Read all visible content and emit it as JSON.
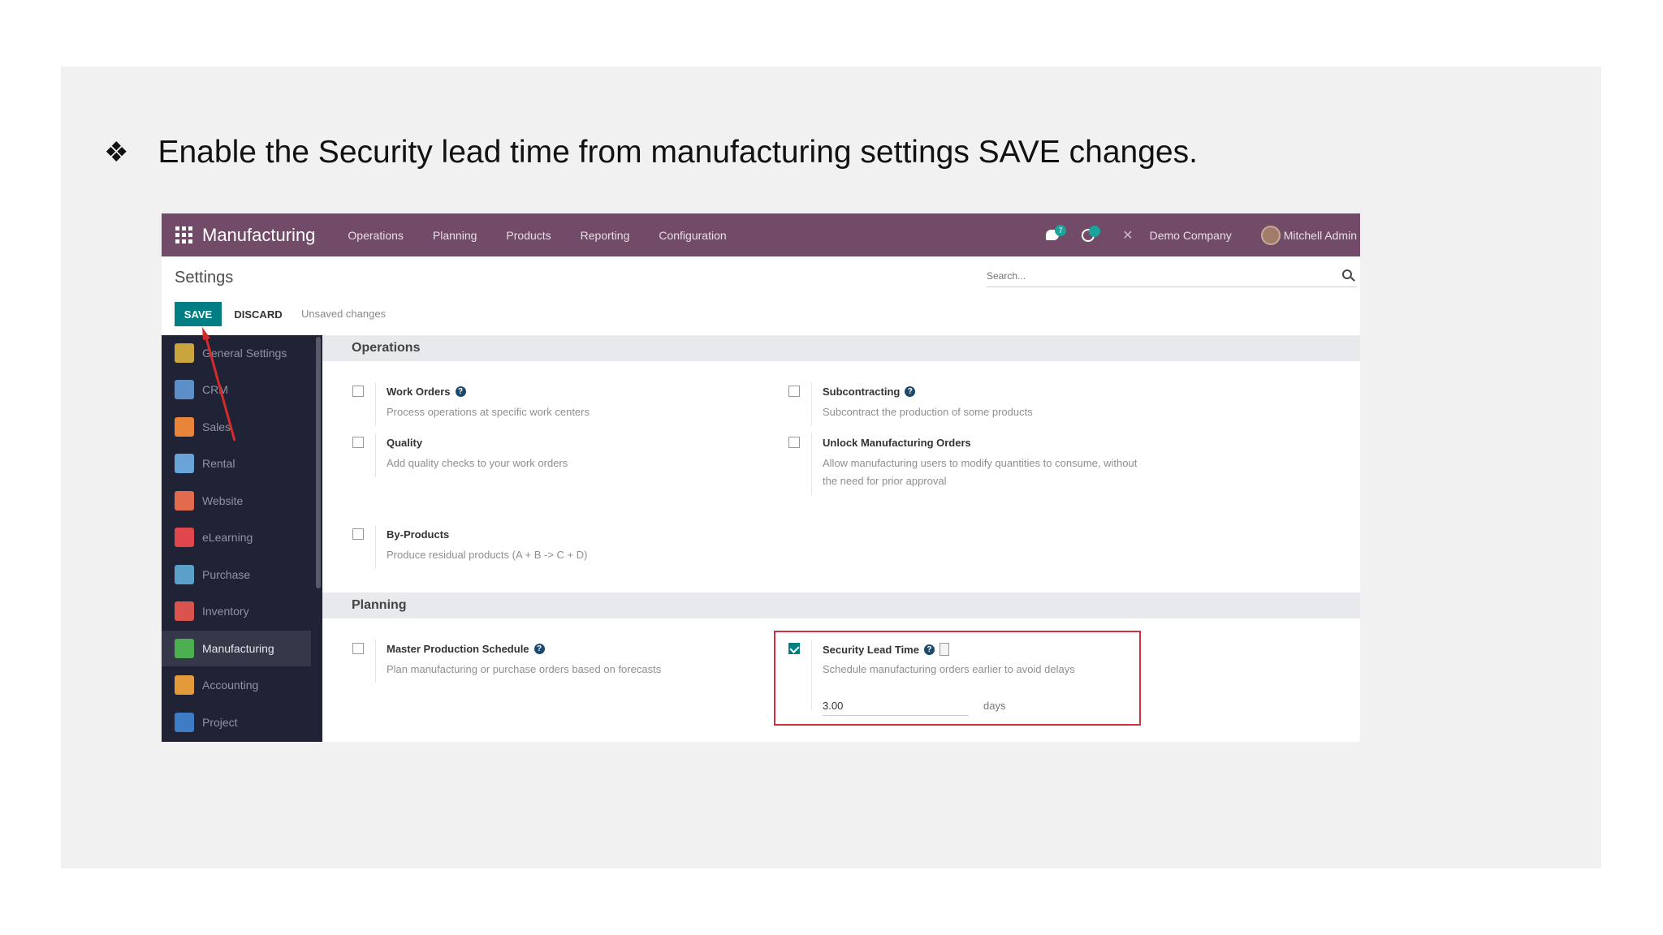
{
  "instruction": {
    "bullet": "❖",
    "text": "Enable the Security lead time from manufacturing settings SAVE changes."
  },
  "topbar": {
    "app_name": "Manufacturing",
    "menus": [
      "Operations",
      "Planning",
      "Products",
      "Reporting",
      "Configuration"
    ],
    "messages_badge": "7",
    "activities_badge": "",
    "company": "Demo Company",
    "user": "Mitchell Admin",
    "colors": {
      "bar": "#714b67"
    }
  },
  "control_panel": {
    "title": "Settings",
    "search_placeholder": "Search...",
    "save_label": "SAVE",
    "discard_label": "DISCARD",
    "status": "Unsaved changes"
  },
  "sidebar": {
    "items": [
      {
        "label": "General Settings",
        "icon": "general-settings-icon",
        "color": "#c9a53d"
      },
      {
        "label": "CRM",
        "icon": "crm-icon",
        "color": "#5c8fc8"
      },
      {
        "label": "Sales",
        "icon": "sales-icon",
        "color": "#e8853b"
      },
      {
        "label": "Rental",
        "icon": "rental-icon",
        "color": "#6aa3d8"
      },
      {
        "label": "Website",
        "icon": "website-icon",
        "color": "#e26a4f"
      },
      {
        "label": "eLearning",
        "icon": "elearning-icon",
        "color": "#e0474c"
      },
      {
        "label": "Purchase",
        "icon": "purchase-icon",
        "color": "#5aa0c8"
      },
      {
        "label": "Inventory",
        "icon": "inventory-icon",
        "color": "#d9534f"
      },
      {
        "label": "Manufacturing",
        "icon": "manufacturing-icon",
        "color": "#4caf50",
        "active": true
      },
      {
        "label": "Accounting",
        "icon": "accounting-icon",
        "color": "#e59a3a"
      },
      {
        "label": "Project",
        "icon": "project-icon",
        "color": "#3f7cc6"
      }
    ]
  },
  "sections": {
    "operations": "Operations",
    "planning": "Planning"
  },
  "settings": {
    "work_orders": {
      "name": "Work Orders",
      "desc": "Process operations at specific work centers",
      "checked": false
    },
    "subcontracting": {
      "name": "Subcontracting",
      "desc": "Subcontract the production of some products",
      "checked": false
    },
    "quality": {
      "name": "Quality",
      "desc": "Add quality checks to your work orders",
      "checked": false
    },
    "unlock_mo": {
      "name": "Unlock Manufacturing Orders",
      "desc1": "Allow manufacturing users to modify quantities to consume, without",
      "desc2": "the need for prior approval",
      "checked": false
    },
    "by_products": {
      "name": "By-Products",
      "desc": "Produce residual products (A + B -> C + D)",
      "checked": false
    },
    "mps": {
      "name": "Master Production Schedule",
      "desc": "Plan manufacturing or purchase orders based on forecasts",
      "checked": false
    },
    "security_lead_time": {
      "name": "Security Lead Time",
      "desc": "Schedule manufacturing orders earlier to avoid delays",
      "value": "3.00",
      "unit": "days",
      "checked": true
    }
  }
}
